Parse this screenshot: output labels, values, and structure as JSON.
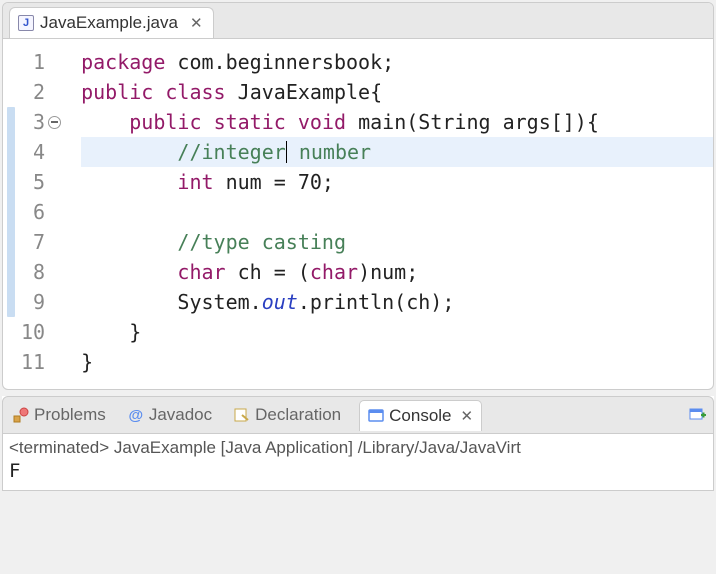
{
  "editor": {
    "tab": {
      "filename": "JavaExample.java",
      "icon": "J"
    },
    "active_line": 4,
    "caret_after_token": "integer",
    "fold_marker_line": 3,
    "change_marker_lines": [
      3,
      4,
      5,
      6,
      7,
      8,
      9
    ],
    "lines": [
      {
        "n": 1,
        "tokens": [
          [
            "kw",
            "package"
          ],
          [
            "id",
            " com.beginnersbook;"
          ]
        ]
      },
      {
        "n": 2,
        "tokens": [
          [
            "kw",
            "public"
          ],
          [
            "id",
            " "
          ],
          [
            "kw",
            "class"
          ],
          [
            "id",
            " JavaExample{"
          ]
        ]
      },
      {
        "n": 3,
        "tokens": [
          [
            "id",
            "    "
          ],
          [
            "kw",
            "public"
          ],
          [
            "id",
            " "
          ],
          [
            "kw",
            "static"
          ],
          [
            "id",
            " "
          ],
          [
            "kw",
            "void"
          ],
          [
            "id",
            " main(String args[]){"
          ]
        ]
      },
      {
        "n": 4,
        "tokens": [
          [
            "id",
            "        "
          ],
          [
            "cm",
            "//integer"
          ],
          [
            "caret",
            ""
          ],
          [
            "cm",
            " number"
          ]
        ]
      },
      {
        "n": 5,
        "tokens": [
          [
            "id",
            "        "
          ],
          [
            "kw",
            "int"
          ],
          [
            "id",
            " num = 70;"
          ]
        ]
      },
      {
        "n": 6,
        "tokens": [
          [
            "id",
            " "
          ]
        ]
      },
      {
        "n": 7,
        "tokens": [
          [
            "id",
            "        "
          ],
          [
            "cm",
            "//type casting"
          ]
        ]
      },
      {
        "n": 8,
        "tokens": [
          [
            "id",
            "        "
          ],
          [
            "kw",
            "char"
          ],
          [
            "id",
            " ch = ("
          ],
          [
            "kw",
            "char"
          ],
          [
            "id",
            ")num;"
          ]
        ]
      },
      {
        "n": 9,
        "tokens": [
          [
            "id",
            "        System."
          ],
          [
            "fld",
            "out"
          ],
          [
            "id",
            ".println(ch);"
          ]
        ]
      },
      {
        "n": 10,
        "tokens": [
          [
            "id",
            "    }"
          ]
        ]
      },
      {
        "n": 11,
        "tokens": [
          [
            "id",
            "}"
          ]
        ]
      }
    ]
  },
  "views": {
    "problems": "Problems",
    "javadoc": "Javadoc",
    "declaration": "Declaration",
    "console": "Console"
  },
  "console": {
    "header": "<terminated> JavaExample [Java Application] /Library/Java/JavaVirt",
    "output": "F"
  }
}
